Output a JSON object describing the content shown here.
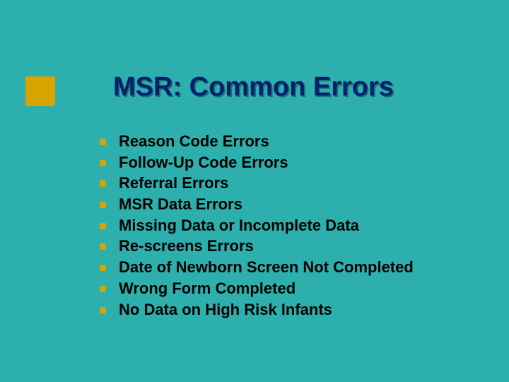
{
  "colors": {
    "background": "#2db0ad",
    "accent": "#d8a400",
    "title": "#021f6d",
    "body_text": "#000000"
  },
  "slide": {
    "title": "MSR: Common Errors",
    "bullets": [
      "Reason Code Errors",
      "Follow-Up Code Errors",
      "Referral Errors",
      "MSR Data Errors",
      " Missing Data or Incomplete Data",
      "Re-screens Errors",
      "Date of Newborn Screen Not Completed",
      "Wrong Form Completed",
      "No Data on High Risk Infants"
    ]
  }
}
